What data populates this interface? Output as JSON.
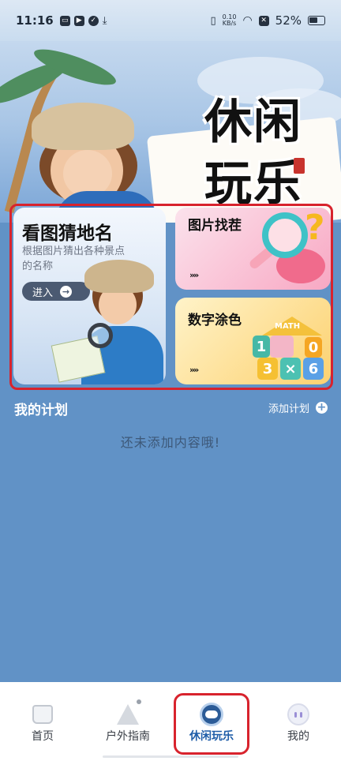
{
  "status_bar": {
    "time": "11:16",
    "net_speed_value": "0.10",
    "net_speed_unit": "KB/s",
    "battery": "52%"
  },
  "hero": {
    "title": "休闲玩乐"
  },
  "games": [
    {
      "title": "看图猜地名",
      "desc": "根据图片猜出各种景点的名称",
      "action": "进入"
    },
    {
      "title": "图片找茬",
      "action": "»»"
    },
    {
      "title": "数字涂色",
      "action": "»»",
      "blocks": [
        "1",
        "0",
        "3",
        "×",
        "6"
      ],
      "roof_label": "MATH"
    }
  ],
  "plan": {
    "title": "我的计划",
    "add_label": "添加计划",
    "empty_text": "还未添加内容哦!"
  },
  "tabs": [
    {
      "label": "首页",
      "icon": "home-icon"
    },
    {
      "label": "户外指南",
      "icon": "compass-icon"
    },
    {
      "label": "休闲玩乐",
      "icon": "gamepad-icon",
      "active": true
    },
    {
      "label": "我的",
      "icon": "profile-icon"
    }
  ],
  "colors": {
    "page_bg": "#6192c6",
    "highlight_frame": "#d8232d",
    "active_tab": "#1f5da8"
  }
}
